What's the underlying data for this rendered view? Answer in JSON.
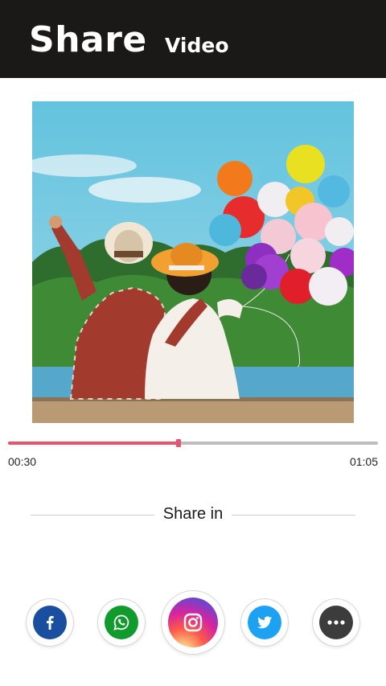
{
  "header": {
    "title": "Share",
    "subtitle": "Video"
  },
  "player": {
    "current_time": "00:30",
    "total_time": "01:05",
    "progress_fraction": 0.4615
  },
  "share": {
    "label": "Share in",
    "buttons": [
      {
        "name": "facebook",
        "icon": "facebook-icon",
        "color": "#1a4fa0"
      },
      {
        "name": "whatsapp",
        "icon": "whatsapp-icon",
        "color": "#109b2c"
      },
      {
        "name": "instagram",
        "icon": "instagram-icon",
        "color": "#d6249f"
      },
      {
        "name": "twitter",
        "icon": "twitter-icon",
        "color": "#1da1f2"
      },
      {
        "name": "more",
        "icon": "more-icon",
        "color": "#3c3c3c"
      }
    ]
  },
  "colors": {
    "header_bg": "#1a1917",
    "accent": "#e7546f",
    "track": "#bdbdbd"
  }
}
